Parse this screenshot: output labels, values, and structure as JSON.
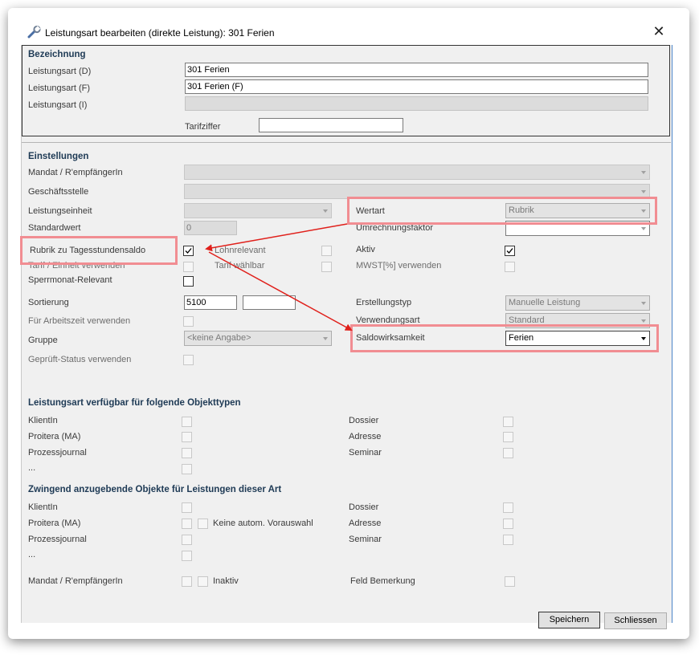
{
  "window": {
    "title": "Leistungsart bearbeiten (direkte Leistung): 301 Ferien",
    "icon": "wrench-icon",
    "close_glyph": "✕"
  },
  "bezeichnung": {
    "header": "Bezeichnung",
    "label_d": "Leistungsart (D)",
    "value_d": "301 Ferien",
    "label_f": "Leistungsart (F)",
    "value_f": "301 Ferien (F)",
    "label_i": "Leistungsart (I)",
    "value_i": "",
    "label_tarif": "Tarifziffer",
    "value_tarif": ""
  },
  "einstellungen": {
    "header": "Einstellungen",
    "mandat_label": "Mandat / R'empfängerIn",
    "geschaeftsstelle_label": "Geschäftsstelle",
    "leistungseinheit_label": "Leistungseinheit",
    "standardwert_label": "Standardwert",
    "standardwert_value": "0",
    "wertart_label": "Wertart",
    "wertart_value": "Rubrik",
    "umrechnung_label": "Umrechnungsfaktor",
    "rubrik_label": "Rubrik zu Tagesstundensaldo",
    "rubrik_checked": true,
    "lohnrelevant_label": "Lohnrelevant",
    "aktiv_label": "Aktiv",
    "aktiv_checked": true,
    "tarif_einheit_label": "Tarif / Einheit verwenden",
    "tarif_waehlbar_label": "Tarif wählbar",
    "mwst_label": "MWST[%] verwenden",
    "sperrmonat_label": "Sperrmonat-Relevant",
    "sortierung_label": "Sortierung",
    "sortierung_value": "5100",
    "sortierung_value2": "",
    "erstellungstyp_label": "Erstellungstyp",
    "erstellungstyp_value": "Manuelle Leistung",
    "arbeitszeit_label": "Für Arbeitszeit verwenden",
    "verwendungsart_label": "Verwendungsart",
    "verwendungsart_value": "Standard",
    "gruppe_label": "Gruppe",
    "gruppe_value": "<keine Angabe>",
    "saldo_label": "Saldowirksamkeit",
    "saldo_value": "Ferien",
    "geprueft_label": "Geprüft-Status verwenden"
  },
  "verfuegbar": {
    "header": "Leistungsart verfügbar für folgende Objekttypen",
    "left": [
      "KlientIn",
      "Proitera (MA)",
      "Prozessjournal",
      "..."
    ],
    "right": [
      "Dossier",
      "Adresse",
      "Seminar"
    ]
  },
  "zwingend": {
    "header": "Zwingend anzugebende Objekte für Leistungen dieser Art",
    "left": [
      "KlientIn",
      "Proitera (MA)",
      "Prozessjournal",
      "..."
    ],
    "right": [
      "Dossier",
      "Adresse",
      "Seminar"
    ],
    "keine_label": "Keine autom. Vorauswahl",
    "mandat_label": "Mandat / R'empfängerIn",
    "inaktiv_label": "Inaktiv",
    "bemerkung_label": "Feld Bemerkung"
  },
  "buttons": {
    "save": "Speichern",
    "close": "Schliessen"
  },
  "colors": {
    "highlight": "#f18d92",
    "arrow": "#e0201b",
    "section_header": "#1e3a55",
    "client_bg": "#f0f0f0"
  }
}
